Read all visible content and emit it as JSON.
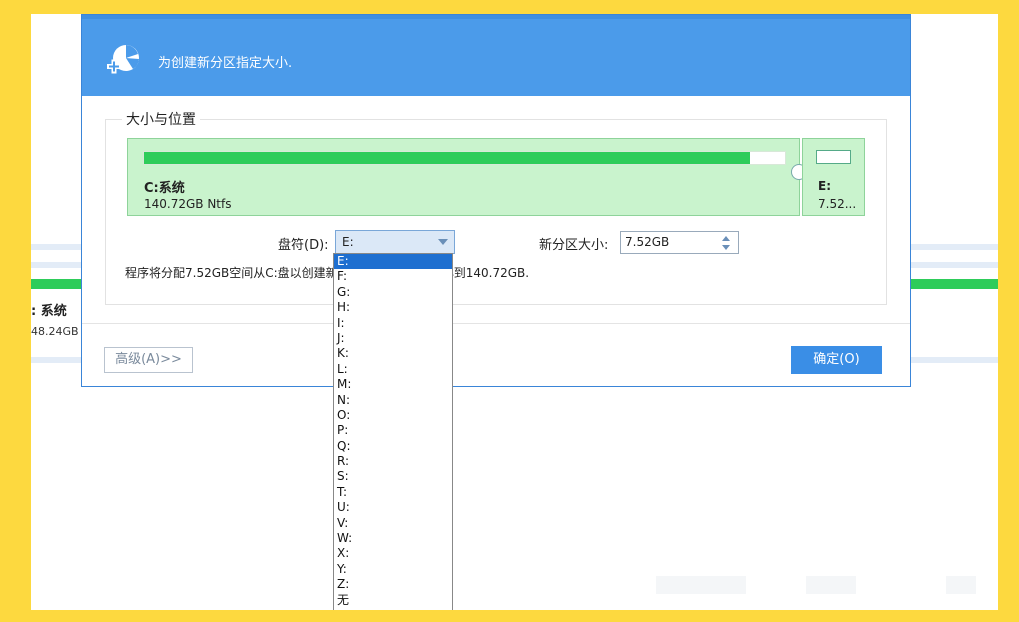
{
  "background": {
    "disk_name": ": 系统",
    "disk_size": "48.24GB"
  },
  "dialog": {
    "title": "为创建新分区指定大小.",
    "group_title": "大小与位置",
    "partition_c": {
      "name": "C:系统",
      "size": "140.72GB Ntfs",
      "fill_fraction": 0.945
    },
    "partition_e": {
      "name": "E:",
      "size": "7.52..."
    },
    "drive_letter_label": "盘符(D):",
    "drive_letter_value": "E:",
    "new_size_label": "新分区大小:",
    "new_size_value": "7.52GB",
    "info_text": "程序将分配7.52GB空间从C:盘以创建新分区. 因此C:盘将减小到140.72GB.",
    "advanced_button": "高级(A)>>",
    "ok_button": "确定(O)",
    "header_color": "#4b9bea",
    "accent_color": "#3a8ee6"
  },
  "dropdown": {
    "selected_index": 0,
    "options": [
      "E:",
      "F:",
      "G:",
      "H:",
      "I:",
      "J:",
      "K:",
      "L:",
      "M:",
      "N:",
      "O:",
      "P:",
      "Q:",
      "R:",
      "S:",
      "T:",
      "U:",
      "V:",
      "W:",
      "X:",
      "Y:",
      "Z:",
      "无"
    ]
  }
}
